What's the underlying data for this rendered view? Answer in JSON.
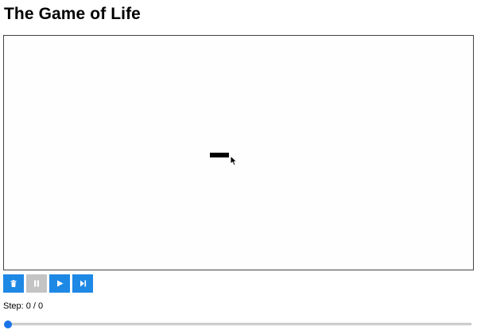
{
  "page": {
    "title": "The Game of Life"
  },
  "board": {
    "live_cells": 3
  },
  "controls": {
    "clear_icon": "trash-icon",
    "pause_icon": "pause-icon",
    "play_icon": "play-icon",
    "step_icon": "step-forward-icon",
    "active_color": "#1e88e5",
    "disabled_color": "#c4c4c4"
  },
  "status": {
    "label": "Step: 0 / 0",
    "current_step": 0,
    "total_steps": 0
  },
  "slider": {
    "value_fraction": 0,
    "thumb_color": "#1a73e8"
  }
}
